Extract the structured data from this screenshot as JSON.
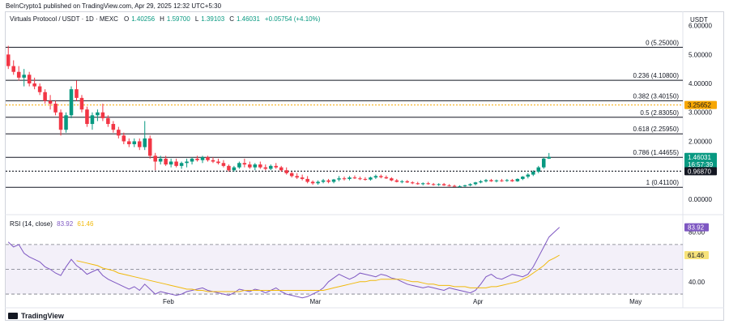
{
  "header": {
    "published": "BeInCrypto1 published on TradingView.com, Apr 29, 2025 12:32 UTC+5:30"
  },
  "legend": {
    "symbol": "Virtuals Protocol / USDT · 1D · MEXC",
    "o_label": "O",
    "o": "1.40256",
    "h_label": "H",
    "h": "1.59700",
    "l_label": "L",
    "l": "1.39103",
    "c_label": "C",
    "c": "1.46031",
    "change": "+0.05754 (+4.10%)"
  },
  "currency": "USDT",
  "rsi_legend": {
    "label": "RSI (14, close)",
    "rsi": "83.92",
    "ma": "61.46"
  },
  "branding": {
    "name": "TradingView"
  },
  "colors": {
    "up": "#089981",
    "down": "#f23645",
    "rsi": "#7e57c2",
    "rsi_ma": "#f0b90b",
    "level_tag": "#f7a600"
  },
  "chart_data": [
    {
      "type": "candlestick",
      "y_axis": {
        "ticks": [
          "6.00000",
          "5.00000",
          "4.00000",
          "3.00000",
          "2.00000",
          "1.00000",
          "0.00000"
        ],
        "tick_values": [
          6,
          5,
          4,
          3,
          2,
          1,
          0
        ],
        "ylim": [
          -0.45,
          6.1
        ]
      },
      "x_axis": {
        "ticks": [
          "Feb",
          "Mar",
          "Apr",
          "May"
        ],
        "tick_days": [
          31,
          59,
          90,
          120
        ],
        "xlim": [
          0,
          129
        ]
      },
      "fib_levels": [
        {
          "label": "0 (5.25000)",
          "value": 5.25
        },
        {
          "label": "0.236 (4.10800)",
          "value": 4.108
        },
        {
          "label": "0.382 (3.40150)",
          "value": 3.4015
        },
        {
          "label": "0.5 (2.83050)",
          "value": 2.8305
        },
        {
          "label": "0.618 (2.25950)",
          "value": 2.2595
        },
        {
          "label": "0.786 (1.44655)",
          "value": 1.44655
        },
        {
          "label": "1 (0.41100)",
          "value": 0.411
        }
      ],
      "price_tags": [
        {
          "label": "3.25652",
          "value": 3.25652,
          "kind": "level"
        },
        {
          "label": "1.46031",
          "sub": "16:57:39",
          "value": 1.46031,
          "kind": "last"
        },
        {
          "label": "0.96870",
          "value": 0.9687,
          "kind": "line"
        }
      ],
      "ohlc": [
        [
          5.0,
          5.3,
          4.5,
          4.6
        ],
        [
          4.6,
          4.8,
          4.3,
          4.4
        ],
        [
          4.4,
          4.6,
          4.1,
          4.2
        ],
        [
          4.2,
          4.5,
          3.9,
          4.3
        ],
        [
          4.3,
          4.4,
          3.9,
          4.0
        ],
        [
          4.0,
          4.2,
          3.8,
          3.9
        ],
        [
          3.9,
          4.0,
          3.6,
          3.7
        ],
        [
          3.7,
          3.8,
          3.3,
          3.4
        ],
        [
          3.4,
          3.6,
          3.1,
          3.3
        ],
        [
          3.3,
          3.4,
          2.9,
          3.0
        ],
        [
          3.0,
          3.1,
          2.2,
          2.4
        ],
        [
          2.4,
          3.0,
          2.3,
          2.9
        ],
        [
          2.9,
          3.9,
          2.8,
          3.8
        ],
        [
          3.8,
          4.1,
          3.4,
          3.5
        ],
        [
          3.5,
          3.6,
          3.0,
          3.1
        ],
        [
          3.1,
          3.2,
          2.5,
          2.6
        ],
        [
          2.6,
          3.0,
          2.4,
          2.9
        ],
        [
          2.9,
          3.1,
          2.7,
          3.0
        ],
        [
          3.0,
          3.3,
          2.7,
          2.8
        ],
        [
          2.8,
          2.9,
          2.5,
          2.6
        ],
        [
          2.6,
          2.7,
          2.3,
          2.4
        ],
        [
          2.4,
          2.5,
          2.1,
          2.2
        ],
        [
          2.2,
          2.3,
          1.9,
          2.0
        ],
        [
          2.0,
          2.1,
          1.8,
          1.9
        ],
        [
          1.9,
          2.1,
          1.8,
          2.0
        ],
        [
          2.0,
          2.1,
          1.7,
          1.8
        ],
        [
          1.8,
          2.7,
          1.7,
          2.1
        ],
        [
          2.1,
          2.2,
          1.4,
          1.5
        ],
        [
          1.5,
          1.6,
          1.0,
          1.3
        ],
        [
          1.3,
          1.5,
          1.2,
          1.4
        ],
        [
          1.4,
          1.5,
          1.15,
          1.2
        ],
        [
          1.2,
          1.4,
          1.1,
          1.3
        ],
        [
          1.3,
          1.4,
          1.1,
          1.15
        ],
        [
          1.15,
          1.3,
          1.05,
          1.25
        ],
        [
          1.25,
          1.4,
          1.1,
          1.3
        ],
        [
          1.3,
          1.45,
          1.2,
          1.4
        ],
        [
          1.4,
          1.5,
          1.3,
          1.35
        ],
        [
          1.35,
          1.5,
          1.25,
          1.45
        ],
        [
          1.45,
          1.5,
          1.3,
          1.35
        ],
        [
          1.35,
          1.45,
          1.25,
          1.3
        ],
        [
          1.3,
          1.4,
          1.2,
          1.25
        ],
        [
          1.25,
          1.35,
          1.1,
          1.15
        ],
        [
          1.15,
          1.2,
          0.95,
          1.0
        ],
        [
          1.0,
          1.15,
          0.95,
          1.1
        ],
        [
          1.1,
          1.3,
          1.05,
          1.25
        ],
        [
          1.25,
          1.4,
          1.1,
          1.2
        ],
        [
          1.2,
          1.3,
          1.05,
          1.1
        ],
        [
          1.1,
          1.25,
          1.0,
          1.2
        ],
        [
          1.2,
          1.3,
          1.05,
          1.1
        ],
        [
          1.1,
          1.2,
          1.0,
          1.05
        ],
        [
          1.05,
          1.2,
          1.0,
          1.15
        ],
        [
          1.15,
          1.25,
          1.05,
          1.1
        ],
        [
          1.1,
          1.15,
          0.95,
          1.0
        ],
        [
          1.0,
          1.1,
          0.85,
          0.9
        ],
        [
          0.9,
          0.95,
          0.75,
          0.8
        ],
        [
          0.8,
          0.9,
          0.7,
          0.75
        ],
        [
          0.75,
          0.85,
          0.65,
          0.7
        ],
        [
          0.7,
          0.8,
          0.55,
          0.6
        ],
        [
          0.6,
          0.65,
          0.5,
          0.55
        ],
        [
          0.55,
          0.65,
          0.5,
          0.6
        ],
        [
          0.6,
          0.7,
          0.55,
          0.65
        ],
        [
          0.65,
          0.7,
          0.55,
          0.6
        ],
        [
          0.6,
          0.7,
          0.55,
          0.68
        ],
        [
          0.68,
          0.8,
          0.62,
          0.72
        ],
        [
          0.72,
          0.78,
          0.65,
          0.7
        ],
        [
          0.7,
          0.8,
          0.65,
          0.75
        ],
        [
          0.75,
          0.82,
          0.7,
          0.72
        ],
        [
          0.72,
          0.78,
          0.66,
          0.7
        ],
        [
          0.7,
          0.76,
          0.64,
          0.68
        ],
        [
          0.68,
          0.78,
          0.64,
          0.75
        ],
        [
          0.75,
          0.85,
          0.7,
          0.8
        ],
        [
          0.8,
          0.85,
          0.72,
          0.76
        ],
        [
          0.76,
          0.82,
          0.7,
          0.72
        ],
        [
          0.72,
          0.76,
          0.62,
          0.65
        ],
        [
          0.65,
          0.7,
          0.58,
          0.6
        ],
        [
          0.6,
          0.66,
          0.55,
          0.62
        ],
        [
          0.62,
          0.66,
          0.56,
          0.58
        ],
        [
          0.58,
          0.62,
          0.52,
          0.55
        ],
        [
          0.55,
          0.6,
          0.5,
          0.52
        ],
        [
          0.52,
          0.58,
          0.48,
          0.55
        ],
        [
          0.55,
          0.6,
          0.5,
          0.52
        ],
        [
          0.52,
          0.56,
          0.47,
          0.5
        ],
        [
          0.5,
          0.55,
          0.46,
          0.52
        ],
        [
          0.52,
          0.56,
          0.46,
          0.48
        ],
        [
          0.48,
          0.52,
          0.44,
          0.46
        ],
        [
          0.46,
          0.5,
          0.42,
          0.44
        ],
        [
          0.44,
          0.48,
          0.41,
          0.45
        ],
        [
          0.45,
          0.5,
          0.42,
          0.48
        ],
        [
          0.48,
          0.55,
          0.45,
          0.52
        ],
        [
          0.52,
          0.6,
          0.48,
          0.58
        ],
        [
          0.58,
          0.66,
          0.55,
          0.62
        ],
        [
          0.62,
          0.7,
          0.58,
          0.66
        ],
        [
          0.66,
          0.7,
          0.6,
          0.62
        ],
        [
          0.62,
          0.68,
          0.58,
          0.65
        ],
        [
          0.65,
          0.7,
          0.6,
          0.64
        ],
        [
          0.64,
          0.7,
          0.6,
          0.66
        ],
        [
          0.66,
          0.7,
          0.6,
          0.62
        ],
        [
          0.62,
          0.72,
          0.6,
          0.7
        ],
        [
          0.7,
          0.8,
          0.66,
          0.78
        ],
        [
          0.78,
          0.9,
          0.72,
          0.85
        ],
        [
          0.85,
          1.0,
          0.8,
          0.95
        ],
        [
          0.95,
          1.15,
          0.9,
          1.1
        ],
        [
          1.1,
          1.45,
          1.05,
          1.40256
        ],
        [
          1.40256,
          1.597,
          1.39103,
          1.46031
        ]
      ]
    },
    {
      "type": "line",
      "name": "RSI (14, close)",
      "y_axis": {
        "ticks": [
          "80.00",
          "40.00"
        ],
        "tick_values": [
          80,
          40
        ],
        "ylim": [
          21.56,
          92.15
        ]
      },
      "bands": [
        70,
        50,
        30
      ],
      "tags": [
        {
          "label": "83.92",
          "value": 83.92,
          "series": "rsi"
        },
        {
          "label": "61.46",
          "value": 61.46,
          "series": "ma"
        }
      ],
      "rsi": [
        72,
        68,
        70,
        63,
        60,
        58,
        56,
        52,
        50,
        47,
        45,
        52,
        58,
        53,
        50,
        46,
        48,
        50,
        45,
        42,
        40,
        38,
        36,
        34,
        36,
        33,
        38,
        34,
        30,
        32,
        31,
        30,
        29,
        30,
        32,
        33,
        34,
        35,
        33,
        32,
        31,
        30,
        29,
        31,
        34,
        33,
        32,
        34,
        33,
        31,
        33,
        35,
        32,
        30,
        29,
        28,
        27,
        28,
        30,
        32,
        35,
        40,
        43,
        46,
        44,
        42,
        44,
        47,
        46,
        45,
        44,
        46,
        45,
        43,
        42,
        40,
        38,
        37,
        36,
        35,
        36,
        35,
        34,
        33,
        35,
        34,
        33,
        32,
        31,
        33,
        38,
        44,
        46,
        43,
        42,
        44,
        46,
        45,
        44,
        46,
        52,
        60,
        68,
        76,
        80,
        83.92
      ],
      "rsi_ma": [
        null,
        null,
        null,
        null,
        null,
        null,
        null,
        null,
        null,
        null,
        null,
        null,
        null,
        57,
        56,
        55,
        54,
        53,
        51,
        50,
        49,
        47,
        46,
        45,
        44,
        43,
        42,
        41,
        40,
        39,
        38,
        37,
        36,
        35,
        34,
        34,
        33,
        33,
        32,
        32,
        32,
        32,
        32,
        32,
        32,
        33,
        33,
        33,
        33,
        33,
        33,
        33,
        33,
        33,
        33,
        33,
        33,
        33,
        33,
        33,
        33,
        34,
        35,
        36,
        37,
        38,
        39,
        40,
        40,
        41,
        41,
        42,
        42,
        42,
        42,
        42,
        41,
        40,
        40,
        39,
        38,
        38,
        37,
        37,
        37,
        36,
        36,
        36,
        35,
        35,
        35,
        35,
        36,
        36,
        37,
        38,
        39,
        40,
        42,
        44,
        47,
        50,
        53,
        57,
        59,
        61.46
      ]
    }
  ]
}
